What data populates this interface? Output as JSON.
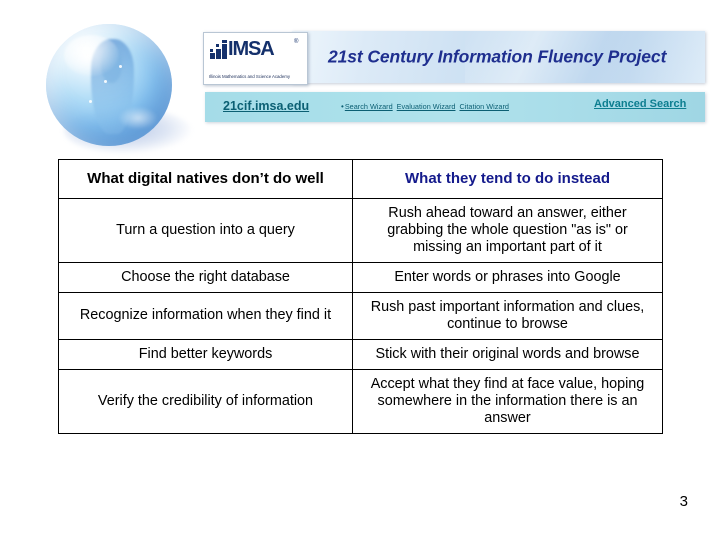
{
  "slide": {
    "page_number": "3"
  },
  "header": {
    "banner_title": "21st Century Information Fluency Project",
    "logo": {
      "wordmark": "IMSA",
      "registered": "®",
      "tagline": "Illinois Mathematics and Science Academy",
      "mark_icon": "imsa-steps-icon"
    },
    "nav": {
      "site_label": "21cif.imsa.edu",
      "bullet": "•",
      "links": [
        {
          "label": "Search Wizard"
        },
        {
          "label": "Evaluation Wizard"
        },
        {
          "label": "Citation Wizard"
        }
      ],
      "advanced_label": "Advanced Search"
    }
  },
  "decoration": {
    "orb_icon": "crystal-ball-icon"
  },
  "table": {
    "headers": {
      "left": "What digital natives don’t do well",
      "right": "What they tend to do instead"
    },
    "rows": [
      {
        "left": "Turn a question into a query",
        "right": "Rush ahead toward an answer, either grabbing the whole question \"as is\" or missing an important part of it",
        "height_class": "row-h-tall"
      },
      {
        "left": "Choose the right database",
        "right": "Enter words or phrases into Google",
        "height_class": "row-h-lo"
      },
      {
        "left": "Recognize information when they find it",
        "right": "Rush past important information and clues, continue to browse",
        "height_class": "row-h-mid"
      },
      {
        "left": "Find better keywords",
        "right": "Stick with their original words and browse",
        "height_class": "row-h-lo"
      },
      {
        "left": "Verify the credibility of information",
        "right": "Accept what they find at face value, hoping somewhere in the information there is an answer",
        "height_class": "row-h-tall"
      }
    ]
  },
  "colors": {
    "banner_text": "#1f2f8f",
    "nav_background": "#a9dfea",
    "nav_link": "#0b5f73",
    "advanced_search": "#0d7e90",
    "header_right_text": "#141a8c",
    "table_border": "#000000",
    "orb_blue": "#7ec0f0"
  }
}
